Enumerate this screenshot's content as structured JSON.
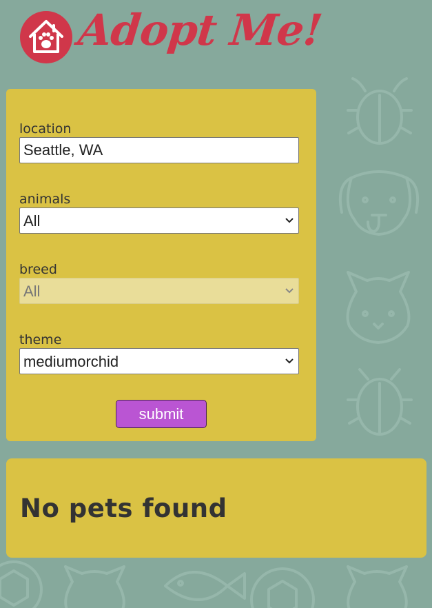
{
  "header": {
    "logo_text": "Adopt Me!"
  },
  "search": {
    "location": {
      "label": "location",
      "value": "Seattle, WA"
    },
    "animal": {
      "label": "animals",
      "selected": "All"
    },
    "breed": {
      "label": "breed",
      "selected": "All",
      "disabled": true
    },
    "theme": {
      "label": "theme",
      "selected": "mediumorchid"
    },
    "submit_label": "submit"
  },
  "results": {
    "empty_message": "No pets found"
  },
  "colors": {
    "background": "#86a99c",
    "panel": "#dac244",
    "logo": "#d0374a",
    "button": "#ba55d3"
  }
}
